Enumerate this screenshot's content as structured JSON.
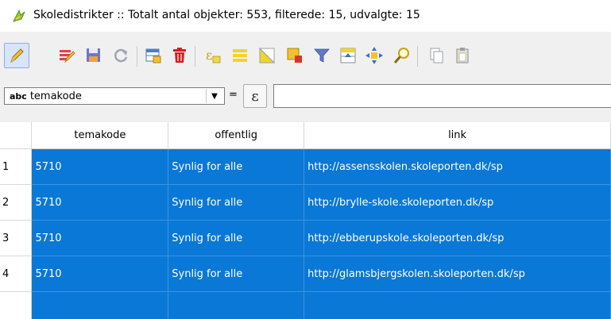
{
  "window": {
    "title": "Skoledistrikter :: Totalt antal objekter: 553, filterede: 15, udvalgte: 15",
    "icon": "qgis-icon"
  },
  "toolbar": {
    "buttons": [
      {
        "name": "toggle-editing-icon",
        "active": true
      },
      {
        "name": "multi-edit-icon"
      },
      {
        "name": "save-edits-icon"
      },
      {
        "name": "reload-icon"
      },
      {
        "name": "add-feature-icon"
      },
      {
        "name": "delete-feature-icon"
      },
      {
        "name": "select-by-expression-icon"
      },
      {
        "name": "select-all-icon"
      },
      {
        "name": "invert-selection-icon"
      },
      {
        "name": "deselect-all-icon"
      },
      {
        "name": "filter-icon"
      },
      {
        "name": "move-selection-to-top-icon"
      },
      {
        "name": "pan-to-selected-icon"
      },
      {
        "name": "zoom-to-selected-icon"
      },
      {
        "name": "copy-icon"
      },
      {
        "name": "paste-icon"
      }
    ]
  },
  "filter": {
    "field_type_label": "abc",
    "field": "temakode",
    "equals": "=",
    "expression_symbol": "ε",
    "value": ""
  },
  "table": {
    "columns": [
      "temakode",
      "offentlig",
      "link"
    ],
    "rows": [
      {
        "num": "1",
        "cells": [
          "5710",
          "Synlig for alle",
          "http://assensskolen.skoleporten.dk/sp"
        ]
      },
      {
        "num": "2",
        "cells": [
          "5710",
          "Synlig for alle",
          "http://brylle-skole.skoleporten.dk/sp"
        ]
      },
      {
        "num": "3",
        "cells": [
          "5710",
          "Synlig for alle",
          "http://ebberupskole.skoleporten.dk/sp"
        ]
      },
      {
        "num": "4",
        "cells": [
          "5710",
          "Synlig for alle",
          "http://glamsbjergskolen.skoleporten.dk/sp"
        ]
      },
      {
        "num": "",
        "cells": [
          "",
          "",
          ""
        ]
      }
    ]
  },
  "colors": {
    "selection": "#0a78d7"
  }
}
